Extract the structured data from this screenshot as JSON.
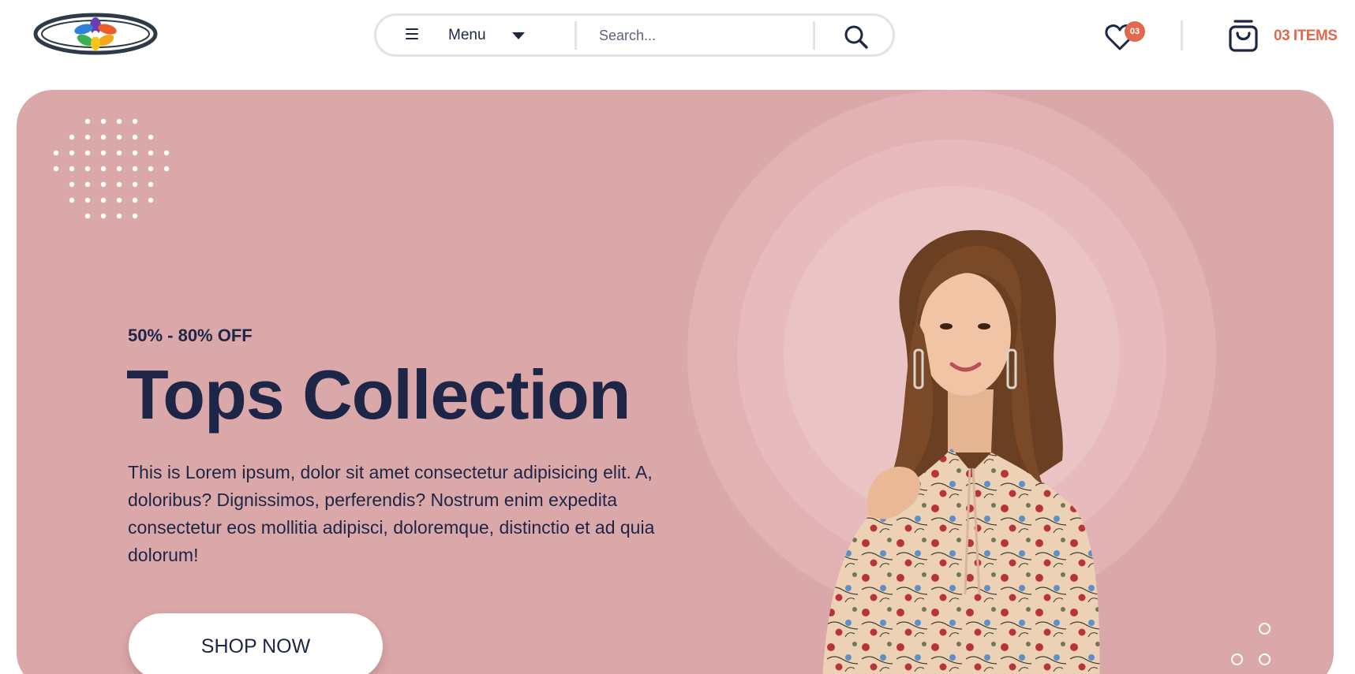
{
  "header": {
    "logo_alt": "logo",
    "menu_label": "Menu",
    "search_placeholder": "Search...",
    "wishlist_count": "03",
    "cart_label": "03 ITEMS"
  },
  "hero": {
    "offer": "50% - 80% OFF",
    "title": "Tops Collection",
    "description": "This is Lorem ipsum, dolor sit amet consectetur adipisicing elit. A, doloribus? Dignissimos, perferendis? Nostrum enim expedita consectetur eos mollitia adipisci, doloremque, distinctio et ad quia dolorum!",
    "cta": "SHOP NOW",
    "slide_count": 3
  },
  "colors": {
    "accent": "#e2694d",
    "hero_bg": "#dba8a9",
    "ink": "#1d2647",
    "border": "#e1e3e7"
  },
  "icons": [
    "hamburger-icon",
    "chevron-down-icon",
    "search-icon",
    "heart-icon",
    "shopping-bag-icon"
  ]
}
